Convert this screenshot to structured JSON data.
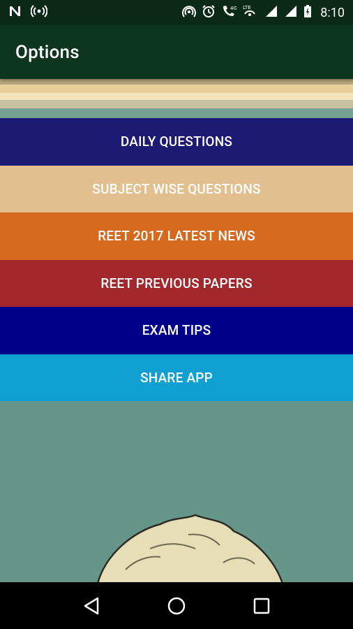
{
  "status_bar": {
    "time": "8:10",
    "icons": [
      "n-icon",
      "broadcast-icon",
      "hotspot-icon",
      "alarm-icon",
      "wifi-call-icon",
      "lte-icon",
      "signal-icon",
      "signal-icon",
      "battery-icon"
    ]
  },
  "app_bar": {
    "title": "Options"
  },
  "menu": {
    "items": [
      {
        "label": "DAILY QUESTIONS",
        "color": "#1d1a73"
      },
      {
        "label": "SUBJECT WISE QUESTIONS",
        "color": "#e1bf8f"
      },
      {
        "label": "REET 2017 LATEST NEWS",
        "color": "#d5691e"
      },
      {
        "label": "REET PREVIOUS PAPERS",
        "color": "#a3282c"
      },
      {
        "label": "EXAM TIPS",
        "color": "#010089"
      },
      {
        "label": "SHARE APP",
        "color": "#0fa0d1"
      }
    ]
  },
  "nav_bar": {
    "icons": [
      "back-icon",
      "home-icon",
      "recents-icon"
    ]
  },
  "colors": {
    "status_bar_bg": "#0a2a17",
    "app_bar_bg": "#0d3520",
    "background": "#66958a"
  }
}
